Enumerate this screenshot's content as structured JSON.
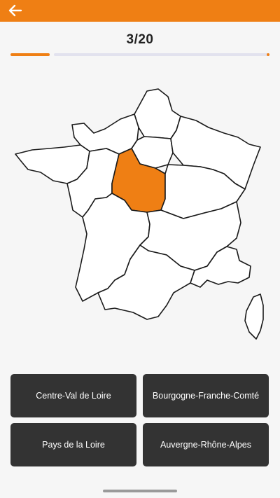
{
  "header": {
    "back_icon": "arrow-left-icon",
    "accent_color": "#ef7f14"
  },
  "quiz": {
    "counter": "3/20",
    "progress_fraction": 0.15
  },
  "map": {
    "highlighted_region": "Centre-Val de Loire",
    "highlight_color": "#ef7f14"
  },
  "answers": [
    {
      "label": "Centre-Val de Loire"
    },
    {
      "label": "Bourgogne-Franche-Comté"
    },
    {
      "label": "Pays de la Loire"
    },
    {
      "label": "Auvergne-Rhône-Alpes"
    }
  ]
}
